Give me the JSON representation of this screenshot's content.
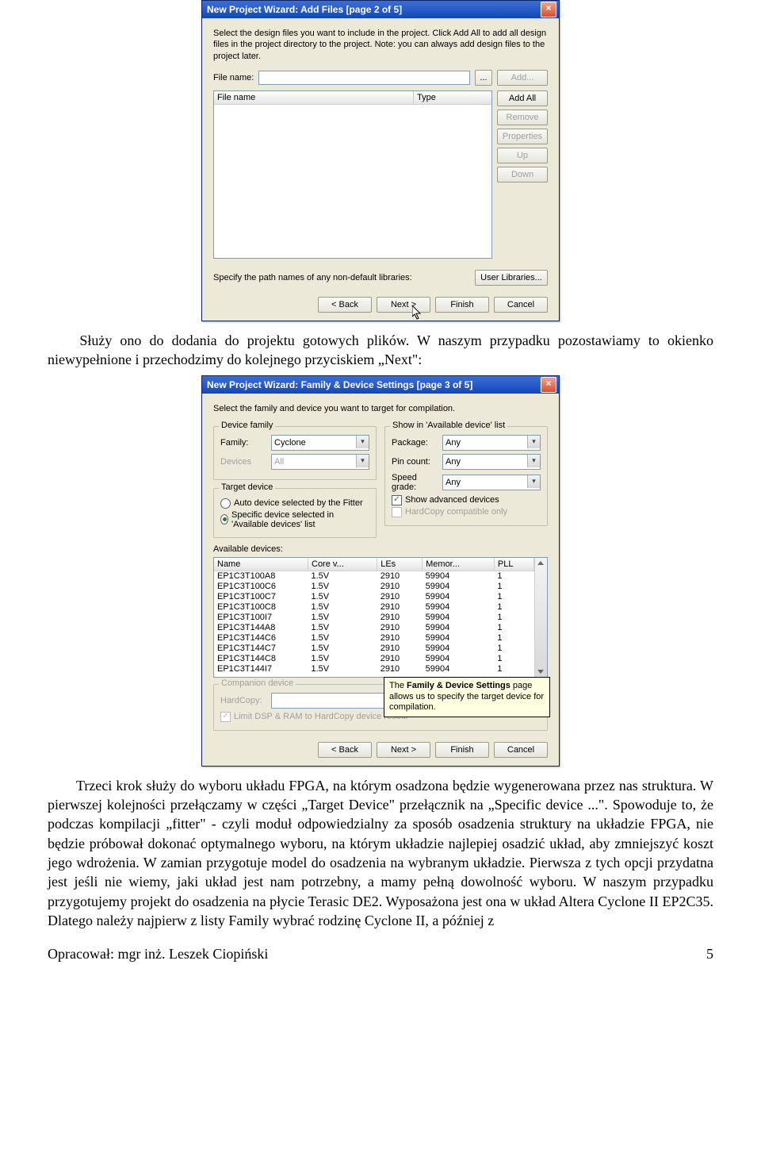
{
  "dialog1": {
    "title": "New Project Wizard: Add Files [page 2 of 5]",
    "instructions": "Select the design files you want to include in the project. Click Add All to add all design files in the project directory to the project. Note: you can always add design files to the project later.",
    "file_label": "File name:",
    "browse": "...",
    "col_filename": "File name",
    "col_type": "Type",
    "buttons": {
      "add": "Add...",
      "add_all": "Add All",
      "remove": "Remove",
      "properties": "Properties",
      "up": "Up",
      "down": "Down"
    },
    "libs_label": "Specify the path names of any non-default libraries:",
    "user_libs": "User Libraries...",
    "nav": {
      "back": "< Back",
      "next": "Next >",
      "finish": "Finish",
      "cancel": "Cancel"
    }
  },
  "para1": "Służy ono do dodania do projektu gotowych plików. W naszym przypadku pozostawiamy to okienko niewypełnione i przechodzimy do kolejnego przyciskiem „Next\":",
  "para1_indent": "    ",
  "dialog2": {
    "title": "New Project Wizard: Family & Device Settings [page 3 of 5]",
    "instructions": "Select the family and device you want to target for compilation.",
    "device_family_legend": "Device family",
    "family_label": "Family:",
    "family_value": "Cyclone",
    "devices_label": "Devices",
    "devices_value": "All",
    "show_legend": "Show in 'Available device' list",
    "package_label": "Package:",
    "package_value": "Any",
    "pincount_label": "Pin count:",
    "pincount_value": "Any",
    "speed_label": "Speed grade:",
    "speed_value": "Any",
    "show_adv": "Show advanced devices",
    "hardcopy_only": "HardCopy compatible only",
    "target_legend": "Target device",
    "radio_auto": "Auto device selected by the Fitter",
    "radio_specific": "Specific device selected in 'Available devices' list",
    "avail_label": "Available devices:",
    "table": {
      "headers": [
        "Name",
        "Core v...",
        "LEs",
        "Memor...",
        "PLL"
      ],
      "rows": [
        [
          "EP1C3T100A8",
          "1.5V",
          "2910",
          "59904",
          "1"
        ],
        [
          "EP1C3T100C6",
          "1.5V",
          "2910",
          "59904",
          "1"
        ],
        [
          "EP1C3T100C7",
          "1.5V",
          "2910",
          "59904",
          "1"
        ],
        [
          "EP1C3T100C8",
          "1.5V",
          "2910",
          "59904",
          "1"
        ],
        [
          "EP1C3T100I7",
          "1.5V",
          "2910",
          "59904",
          "1"
        ],
        [
          "EP1C3T144A8",
          "1.5V",
          "2910",
          "59904",
          "1"
        ],
        [
          "EP1C3T144C6",
          "1.5V",
          "2910",
          "59904",
          "1"
        ],
        [
          "EP1C3T144C7",
          "1.5V",
          "2910",
          "59904",
          "1"
        ],
        [
          "EP1C3T144C8",
          "1.5V",
          "2910",
          "59904",
          "1"
        ],
        [
          "EP1C3T144I7",
          "1.5V",
          "2910",
          "59904",
          "1"
        ]
      ]
    },
    "companion_legend": "Companion device",
    "hardcopy_label": "HardCopy:",
    "limit_dsp": "Limit DSP & RAM to HardCopy device resour",
    "tooltip_prefix": "The ",
    "tooltip_bold": "Family & Device Settings",
    "tooltip_rest": " page allows us to specify the target device for compilation.",
    "nav": {
      "back": "< Back",
      "next": "Next >",
      "finish": "Finish",
      "cancel": "Cancel"
    }
  },
  "para2": "Trzeci krok służy do wyboru układu FPGA, na którym osadzona będzie wygenerowana przez nas struktura. W pierwszej kolejności przełączamy w części „Target Device\" przełącznik na „Specific device ...\". Spowoduje to, że podczas kompilacji „fitter\" - czyli moduł odpowiedzialny za sposób osadzenia struktury na układzie FPGA, nie będzie próbował dokonać optymalnego wyboru, na którym układzie najlepiej osadzić układ, aby zmniejszyć koszt jego wdrożenia. W zamian przygotuje model do osadzenia na wybranym układzie. Pierwsza z tych opcji przydatna jest jeśli nie wiemy, jaki układ jest nam potrzebny, a mamy pełną dowolność wyboru. W naszym przypadku przygotujemy projekt do osadzenia na płycie Terasic DE2. Wyposażona jest ona w układ Altera Cyclone II EP2C35. Dlatego należy najpierw z listy Family wybrać rodzinę Cyclone II, a później z",
  "footer": {
    "author": "Opracował: mgr inż. Leszek Ciopiński",
    "page": "5"
  }
}
